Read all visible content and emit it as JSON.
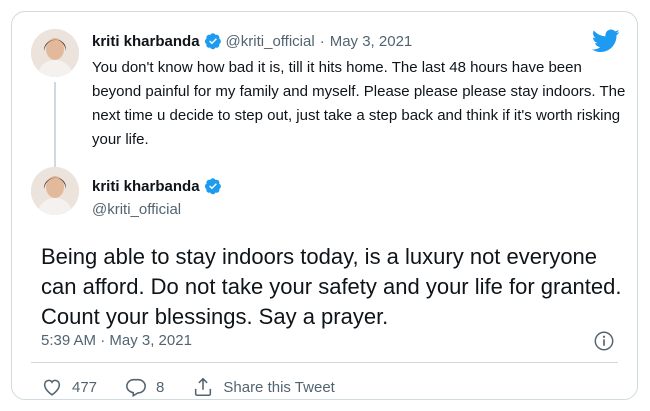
{
  "parent_tweet": {
    "name": "kriti kharbanda",
    "handle": "@kriti_official",
    "separator": "·",
    "date": "May 3, 2021",
    "text": "You don't know how bad it is, till it hits home. The last 48 hours have been beyond painful for my family and myself. Please please please stay indoors. The next time u decide to step out, just take a step back and think if it's worth risking your life."
  },
  "main_tweet": {
    "name": "kriti kharbanda",
    "handle": "@kriti_official",
    "text": "Being able to stay indoors today, is a luxury not everyone can afford. Do not take your safety and your life for granted. Count your blessings. Say a prayer.",
    "timestamp": "5:39 AM · May 3, 2021"
  },
  "actions": {
    "likes": "477",
    "replies": "8",
    "share_label": "Share this Tweet"
  },
  "colors": {
    "brand_blue": "#1d9bf0",
    "muted": "#536471",
    "border": "#cfd9de"
  },
  "icons": [
    "twitter-bird-icon",
    "verified-badge-icon",
    "info-icon",
    "heart-icon",
    "reply-icon",
    "share-icon"
  ]
}
